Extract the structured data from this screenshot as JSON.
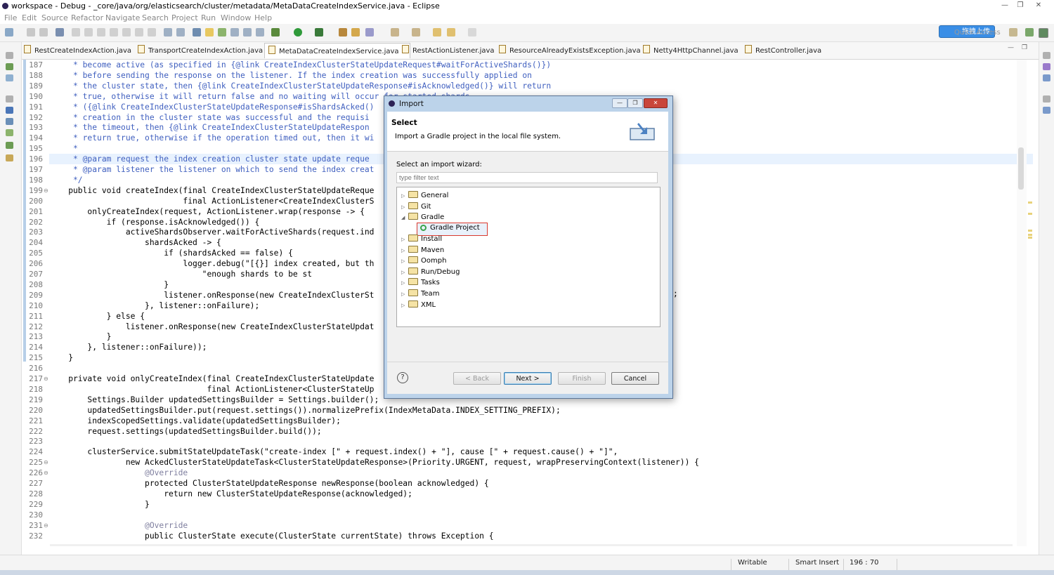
{
  "window": {
    "title": "workspace - Debug - _core/java/org/elasticsearch/cluster/metadata/MetaDataCreateIndexService.java - Eclipse"
  },
  "menu": [
    "File",
    "Edit",
    "Source",
    "Refactor",
    "Navigate",
    "Search",
    "Project",
    "Run",
    "Window",
    "Help"
  ],
  "toolbar": {
    "quick_access": "Quick Access",
    "upload_label": "拖拽上传"
  },
  "tabs": [
    {
      "label": "RestCreateIndexAction.java",
      "active": false
    },
    {
      "label": "TransportCreateIndexAction.java",
      "active": false
    },
    {
      "label": "MetaDataCreateIndexService.java",
      "active": true
    },
    {
      "label": "RestActionListener.java",
      "active": false
    },
    {
      "label": "ResourceAlreadyExistsException.java",
      "active": false
    },
    {
      "label": "Netty4HttpChannel.java",
      "active": false
    },
    {
      "label": "RestController.java",
      "active": false
    }
  ],
  "editor": {
    "lines": [
      {
        "n": "187",
        "t": "     * become active (as specified in {@link CreateIndexClusterStateUpdateRequest#waitForActiveShards()})",
        "c": "cm"
      },
      {
        "n": "188",
        "t": "     * before sending the response on the listener. If the index creation was successfully applied on",
        "c": "cm"
      },
      {
        "n": "189",
        "t": "     * the cluster state, then {@link CreateIndexClusterStateUpdateResponse#isAcknowledged()} will return",
        "c": "cm"
      },
      {
        "n": "190",
        "t": "     * true, otherwise it will return false and no waiting will occur for started shards.",
        "c": "cm"
      },
      {
        "n": "191",
        "t": "     * ({@link CreateIndexClusterStateUpdateResponse#isShardsAcked()",
        "c": "cm"
      },
      {
        "n": "192",
        "t": "     * creation in the cluster state was successful and the requisi",
        "c": "cm"
      },
      {
        "n": "193",
        "t": "     * the timeout, then {@link CreateIndexClusterStateUpdateRespon",
        "c": "cm"
      },
      {
        "n": "194",
        "t": "     * return true, otherwise if the operation timed out, then it wi",
        "c": "cm"
      },
      {
        "n": "195",
        "t": "     *",
        "c": "cm"
      },
      {
        "n": "196",
        "t": "     * @param request the index creation cluster state update reque",
        "c": "cm"
      },
      {
        "n": "197",
        "t": "     * @param listener the listener on which to send the index creat",
        "c": "cm"
      },
      {
        "n": "198",
        "t": "     */",
        "c": "cm"
      },
      {
        "n": "199",
        "t": "    public void createIndex(final CreateIndexClusterStateUpdateReque",
        "c": ""
      },
      {
        "n": "200",
        "t": "                            final ActionListener<CreateIndexClusterS",
        "c": ""
      },
      {
        "n": "201",
        "t": "        onlyCreateIndex(request, ActionListener.wrap(response -> {",
        "c": ""
      },
      {
        "n": "202",
        "t": "            if (response.isAcknowledged()) {",
        "c": ""
      },
      {
        "n": "203",
        "t": "                activeShardsObserver.waitForActiveShards(request.ind",
        "c": ""
      },
      {
        "n": "204",
        "t": "                    shardsAcked -> {",
        "c": ""
      },
      {
        "n": "205",
        "t": "                        if (shardsAcked == false) {",
        "c": ""
      },
      {
        "n": "206",
        "t": "                            logger.debug(\"[{}] index created, but th",
        "c": ""
      },
      {
        "n": "207",
        "t": "                                \"enough shards to be st",
        "c": ""
      },
      {
        "n": "208",
        "t": "                        }",
        "c": ""
      },
      {
        "n": "209",
        "t": "                        listener.onResponse(new CreateIndexClusterSt",
        "c": ""
      },
      {
        "n": "210",
        "t": "                    }, listener::onFailure);",
        "c": ""
      },
      {
        "n": "211",
        "t": "            } else {",
        "c": ""
      },
      {
        "n": "212",
        "t": "                listener.onResponse(new CreateIndexClusterStateUpdat",
        "c": ""
      },
      {
        "n": "213",
        "t": "            }",
        "c": ""
      },
      {
        "n": "214",
        "t": "        }, listener::onFailure));",
        "c": ""
      },
      {
        "n": "215",
        "t": "    }",
        "c": ""
      },
      {
        "n": "216",
        "t": "",
        "c": ""
      },
      {
        "n": "217",
        "t": "    private void onlyCreateIndex(final CreateIndexClusterStateUpdate",
        "c": ""
      },
      {
        "n": "218",
        "t": "                                 final ActionListener<ClusterStateUp",
        "c": ""
      },
      {
        "n": "219",
        "t": "        Settings.Builder updatedSettingsBuilder = Settings.builder();",
        "c": ""
      },
      {
        "n": "220",
        "t": "        updatedSettingsBuilder.put(request.settings()).normalizePrefix(IndexMetaData.INDEX_SETTING_PREFIX);",
        "c": ""
      },
      {
        "n": "221",
        "t": "        indexScopedSettings.validate(updatedSettingsBuilder);",
        "c": ""
      },
      {
        "n": "222",
        "t": "        request.settings(updatedSettingsBuilder.build());",
        "c": ""
      },
      {
        "n": "223",
        "t": "",
        "c": ""
      },
      {
        "n": "224",
        "t": "        clusterService.submitStateUpdateTask(\"create-index [\" + request.index() + \"], cause [\" + request.cause() + \"]\",",
        "c": ""
      },
      {
        "n": "225",
        "t": "                new AckedClusterStateUpdateTask<ClusterStateUpdateResponse>(Priority.URGENT, request, wrapPreservingContext(listener)) {",
        "c": ""
      },
      {
        "n": "226",
        "t": "                    @Override",
        "c": "dim"
      },
      {
        "n": "227",
        "t": "                    protected ClusterStateUpdateResponse newResponse(boolean acknowledged) {",
        "c": ""
      },
      {
        "n": "228",
        "t": "                        return new ClusterStateUpdateResponse(acknowledged);",
        "c": ""
      },
      {
        "n": "229",
        "t": "                    }",
        "c": ""
      },
      {
        "n": "230",
        "t": "",
        "c": ""
      },
      {
        "n": "231",
        "t": "                    @Override",
        "c": "dim"
      },
      {
        "n": "232",
        "t": "                    public ClusterState execute(ClusterState currentState) throws Exception {",
        "c": ""
      }
    ],
    "trailing_semicolon": ";"
  },
  "status": {
    "writable": "Writable",
    "insert_mode": "Smart Insert",
    "position": "196 : 70"
  },
  "dialog": {
    "title": "Import",
    "header_title": "Select",
    "header_desc": "Import a Gradle project in the local file system.",
    "wizard_label": "Select an import wizard:",
    "filter_placeholder": "type filter text",
    "tree": [
      {
        "label": "General",
        "state": "collapsed",
        "level": 0
      },
      {
        "label": "Git",
        "state": "collapsed",
        "level": 0
      },
      {
        "label": "Gradle",
        "state": "expanded",
        "level": 0
      },
      {
        "label": "Gradle Project",
        "state": "leaf",
        "level": 1,
        "selected": true
      },
      {
        "label": "Install",
        "state": "collapsed",
        "level": 0
      },
      {
        "label": "Maven",
        "state": "collapsed",
        "level": 0
      },
      {
        "label": "Oomph",
        "state": "collapsed",
        "level": 0
      },
      {
        "label": "Run/Debug",
        "state": "collapsed",
        "level": 0
      },
      {
        "label": "Tasks",
        "state": "collapsed",
        "level": 0
      },
      {
        "label": "Team",
        "state": "collapsed",
        "level": 0
      },
      {
        "label": "XML",
        "state": "collapsed",
        "level": 0
      }
    ],
    "buttons": {
      "back": "< Back",
      "next": "Next >",
      "finish": "Finish",
      "cancel": "Cancel",
      "help": "?"
    }
  }
}
